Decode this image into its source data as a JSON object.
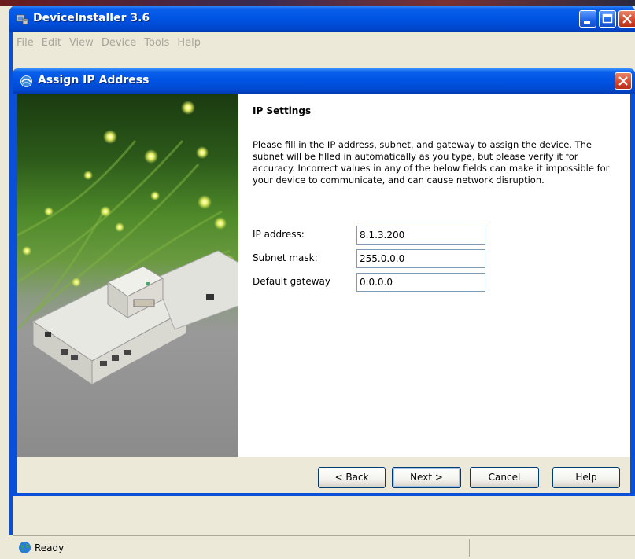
{
  "window": {
    "title": "DeviceInstaller 3.6",
    "menu": [
      "File",
      "Edit",
      "View",
      "Device",
      "Tools",
      "Help"
    ],
    "status": "Ready"
  },
  "dialog": {
    "title": "Assign IP Address",
    "section_title": "IP Settings",
    "description": "Please fill in the IP address, subnet, and gateway to assign the device. The subnet will be filled in automatically as you type, but please verify it for accuracy.  Incorrect values in any of the below fields can make it impossible for your device to communicate, and can cause network disruption.",
    "fields": [
      {
        "label": "IP address:",
        "value": "8.1.3.200"
      },
      {
        "label": "Subnet mask:",
        "value": "255.0.0.0"
      },
      {
        "label": "Default gateway",
        "value": "0.0.0.0"
      }
    ],
    "buttons": {
      "back": "< Back",
      "next": "Next >",
      "cancel": "Cancel",
      "help": "Help"
    }
  },
  "colors": {
    "title_bar_blue": "#0054E3",
    "close_red": "#D4462B",
    "dialog_bg": "#ECE9D8"
  }
}
